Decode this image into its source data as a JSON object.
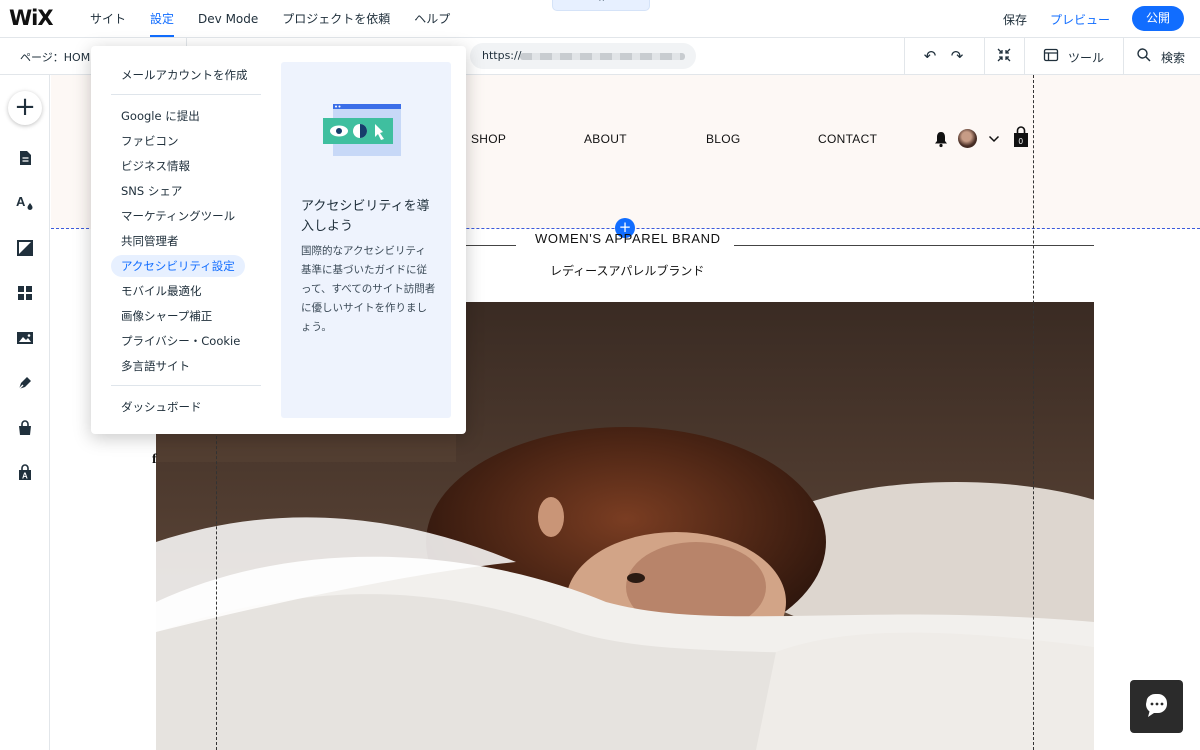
{
  "topbar": {
    "logo": "WiX",
    "menu": [
      {
        "label": "サイト"
      },
      {
        "label": "設定"
      },
      {
        "label": "Dev Mode"
      },
      {
        "label": "プロジェクトを依頼"
      },
      {
        "label": "ヘルプ"
      }
    ],
    "save_label": "保存",
    "preview_label": "プレビュー",
    "publish_label": "公開",
    "accent_color": "#116dff"
  },
  "subbar": {
    "page_label": "ページ：HOM",
    "url_prefix": "https://",
    "tools_label": "ツール",
    "search_label": "検索"
  },
  "site": {
    "nav": [
      "SHOP",
      "ABOUT",
      "BLOG",
      "CONTACT"
    ],
    "brand": "WOMEN'S APPAREL BRAND",
    "brand_sub": "レディースアパレルブランド",
    "social": "f"
  },
  "dropdown": {
    "items": [
      {
        "label": "メールアカウントを作成"
      },
      {
        "label": "Google に提出"
      },
      {
        "label": "ファビコン"
      },
      {
        "label": "ビジネス情報"
      },
      {
        "label": "SNS シェア"
      },
      {
        "label": "マーケティングツール"
      },
      {
        "label": "共同管理者"
      },
      {
        "label": "アクセシビリティ設定"
      },
      {
        "label": "モバイル最適化"
      },
      {
        "label": "画像シャープ補正"
      },
      {
        "label": "プライバシー・Cookie"
      },
      {
        "label": "多言語サイト"
      },
      {
        "label": "ダッシュボード"
      }
    ],
    "panel": {
      "title": "アクセシビリティを導入しよう",
      "text": "国際的なアクセシビリティ基準に基づいたガイドに従って、すべてのサイト訪問者に優しいサイトを作りましょう。"
    }
  }
}
